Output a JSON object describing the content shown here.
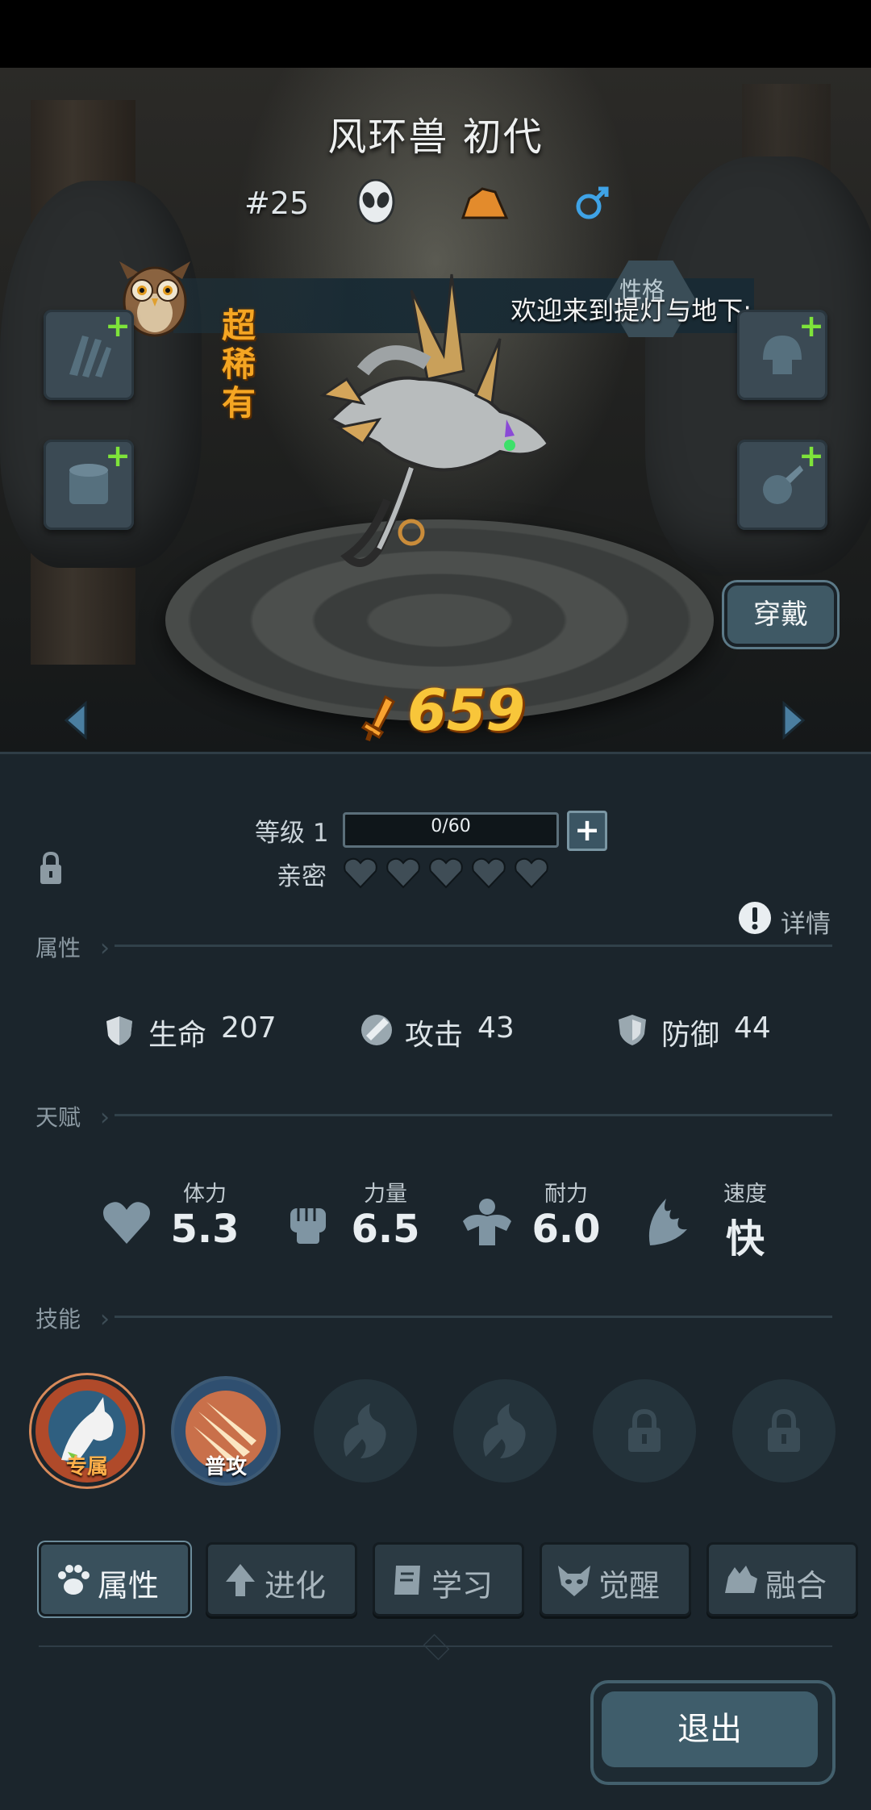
{
  "pet": {
    "name": "风环兽 初代",
    "number": "#25",
    "rarity": "超稀有",
    "power": "659"
  },
  "banner": {
    "text": "欢迎来到提灯与地下:",
    "personality_label": "性格"
  },
  "actions": {
    "wear_label": "穿戴",
    "exit_label": "退出"
  },
  "level": {
    "label": "等级 1",
    "progress_text": "0/60",
    "progress_fraction": 0,
    "intimacy_label": "亲密",
    "intimacy_hearts_filled": 0,
    "intimacy_hearts_total": 5,
    "details_label": "详情"
  },
  "sections": {
    "attributes": "属性",
    "talents": "天赋",
    "skills": "技能"
  },
  "stats": [
    {
      "label": "生命",
      "value": "207",
      "icon": "hp-shield-icon"
    },
    {
      "label": "攻击",
      "value": "43",
      "icon": "attack-sword-icon"
    },
    {
      "label": "防御",
      "value": "44",
      "icon": "defense-shield-icon"
    }
  ],
  "talents": [
    {
      "label": "体力",
      "value": "5.3",
      "icon": "heart-icon"
    },
    {
      "label": "力量",
      "value": "6.5",
      "icon": "fist-icon"
    },
    {
      "label": "耐力",
      "value": "6.0",
      "icon": "muscle-icon"
    },
    {
      "label": "速度",
      "value": "快",
      "icon": "wing-icon"
    }
  ],
  "skills": [
    {
      "label": "专属",
      "state": "unlocked"
    },
    {
      "label": "普攻",
      "state": "unlocked"
    },
    {
      "label": "",
      "state": "empty"
    },
    {
      "label": "",
      "state": "empty"
    },
    {
      "label": "",
      "state": "locked"
    },
    {
      "label": "",
      "state": "locked"
    }
  ],
  "tabs": [
    {
      "label": "属性",
      "icon": "paw-icon",
      "active": true
    },
    {
      "label": "进化",
      "icon": "evolve-arrow-icon",
      "active": false
    },
    {
      "label": "学习",
      "icon": "book-icon",
      "active": false
    },
    {
      "label": "觉醒",
      "icon": "awaken-mask-icon",
      "active": false
    },
    {
      "label": "融合",
      "icon": "fusion-beast-icon",
      "active": false
    }
  ],
  "colors": {
    "rarity": "#f5a623",
    "power": "#f8c63a",
    "gender_male": "#3fa3e6",
    "add_green": "#7ee33a",
    "panel_bg": "#1b252c"
  }
}
